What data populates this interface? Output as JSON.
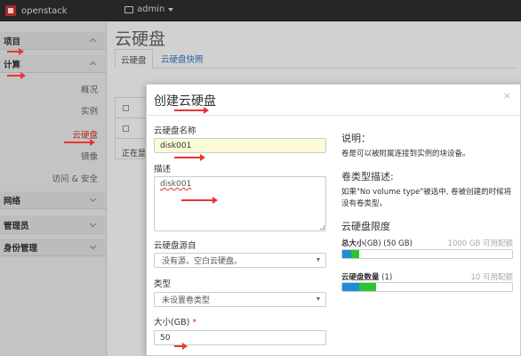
{
  "topbar": {
    "brand": "openstack",
    "user_menu": "admin"
  },
  "sidebar": {
    "project": "项目",
    "compute": "计算",
    "items": [
      "概况",
      "实例",
      "云硬盘",
      "镜像",
      "访问 & 安全"
    ],
    "network": "网络",
    "admin": "管理员",
    "identity": "身份管理"
  },
  "main": {
    "title": "云硬盘",
    "tabs": [
      "云硬盘",
      "云硬盘快照"
    ],
    "loading_text": "正在显"
  },
  "modal": {
    "title": "创建云硬盘",
    "close": "×",
    "name_label": "云硬盘名称",
    "name_value": "disk001",
    "desc_label": "描述",
    "desc_value": "disk001",
    "source_label": "云硬盘源自",
    "source_value": "没有源，空白云硬盘。",
    "type_label": "类型",
    "type_value": "未设置卷类型",
    "size_label": "大小(GB)",
    "size_required": "*",
    "size_value": "50",
    "info_title": "说明：",
    "info_text": "卷是可以被附属连接到实例的块设备。",
    "vtype_title": "卷类型描述:",
    "vtype_text": "如果\"No volume type\"被选中, 卷被创建的时候将没有卷类型。",
    "quota_title": "云硬盘限度",
    "quota_total_label": "总大小",
    "quota_total_value": "(GB) (50 GB)",
    "quota_total_avail": "1000 GB 可用配额",
    "quota_count_label": "云硬盘数量",
    "quota_count_value": " (1)",
    "quota_count_avail": "10 可用配额"
  },
  "quota_bars": {
    "size": {
      "used_fraction": 0.05,
      "added_fraction": 0.05
    },
    "count": {
      "used_fraction": 0.1,
      "added_fraction": 0.1
    }
  },
  "colors": {
    "accent": "#d8322b",
    "used": "#1f8dd6",
    "added": "#2cc42c",
    "arrow": "#e33333"
  }
}
